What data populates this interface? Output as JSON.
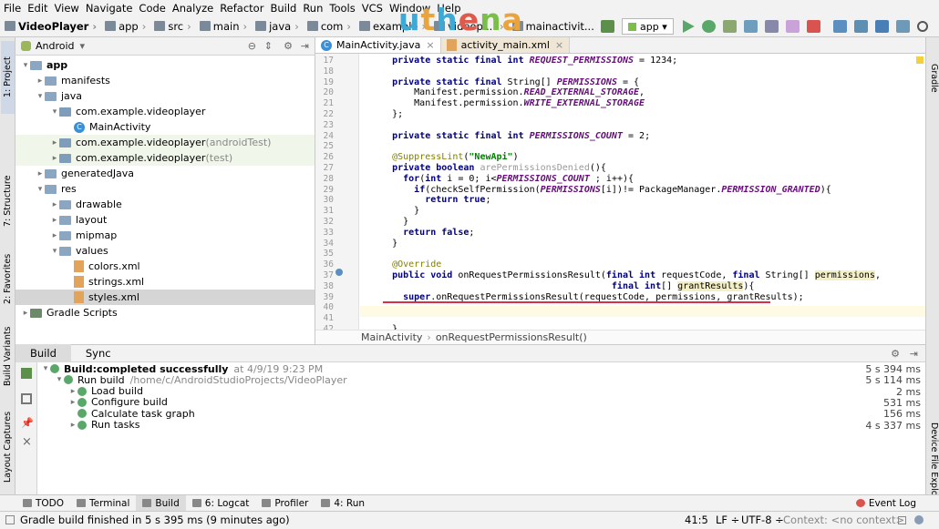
{
  "menu": [
    "File",
    "Edit",
    "View",
    "Navigate",
    "Code",
    "Analyze",
    "Refactor",
    "Build",
    "Run",
    "Tools",
    "VCS",
    "Window",
    "Help"
  ],
  "breadcrumb": [
    "VideoPlayer",
    "app",
    "src",
    "main",
    "java",
    "com",
    "example",
    "videopl...",
    "mainactivit..."
  ],
  "watermark": "uthena",
  "run_config": "app",
  "project_view": "Android",
  "tree": [
    {
      "label": "app",
      "depth": 0,
      "arrow": "▾",
      "icon": "folder"
    },
    {
      "label": "manifests",
      "depth": 1,
      "arrow": "▸",
      "icon": "folder"
    },
    {
      "label": "java",
      "depth": 1,
      "arrow": "▾",
      "icon": "folder"
    },
    {
      "label": "com.example.videoplayer",
      "depth": 2,
      "arrow": "▾",
      "icon": "package"
    },
    {
      "label": "MainActivity",
      "depth": 3,
      "arrow": "",
      "icon": "class"
    },
    {
      "label": "com.example.videoplayer",
      "suffix": " (androidTest)",
      "depth": 2,
      "arrow": "▸",
      "icon": "package"
    },
    {
      "label": "com.example.videoplayer",
      "suffix": " (test)",
      "depth": 2,
      "arrow": "▸",
      "icon": "package"
    },
    {
      "label": "generatedJava",
      "depth": 1,
      "arrow": "▸",
      "icon": "folder"
    },
    {
      "label": "res",
      "depth": 1,
      "arrow": "▾",
      "icon": "folder"
    },
    {
      "label": "drawable",
      "depth": 2,
      "arrow": "▸",
      "icon": "folder"
    },
    {
      "label": "layout",
      "depth": 2,
      "arrow": "▸",
      "icon": "folder"
    },
    {
      "label": "mipmap",
      "depth": 2,
      "arrow": "▸",
      "icon": "folder"
    },
    {
      "label": "values",
      "depth": 2,
      "arrow": "▾",
      "icon": "folder"
    },
    {
      "label": "colors.xml",
      "depth": 3,
      "arrow": "",
      "icon": "xml"
    },
    {
      "label": "strings.xml",
      "depth": 3,
      "arrow": "",
      "icon": "xml"
    },
    {
      "label": "styles.xml",
      "depth": 3,
      "arrow": "",
      "icon": "xml"
    },
    {
      "label": "Gradle Scripts",
      "depth": 0,
      "arrow": "▸",
      "icon": "gradle"
    }
  ],
  "left_tabs": [
    "1: Project",
    "7: Structure",
    "2: Favorites",
    "Build Variants",
    "Layout Captures"
  ],
  "right_tabs": [
    "Gradle",
    "Device File Explorer"
  ],
  "editor_tabs": [
    {
      "label": "MainActivity.java",
      "active": true
    },
    {
      "label": "activity_main.xml",
      "active": false
    }
  ],
  "code_lines": [
    {
      "n": "17",
      "html": "    <span class=\"kw\">private static final int</span> <span class=\"cn\">REQUEST_PERMISSIONS</span> = 1234;"
    },
    {
      "n": "18",
      "html": ""
    },
    {
      "n": "19",
      "html": "    <span class=\"kw\">private static final</span> String[] <span class=\"cn\">PERMISSIONS</span> = {"
    },
    {
      "n": "20",
      "html": "        Manifest.permission.<span class=\"cn\">READ_EXTERNAL_STORAGE</span>,"
    },
    {
      "n": "21",
      "html": "        Manifest.permission.<span class=\"cn\">WRITE_EXTERNAL_STORAGE</span>"
    },
    {
      "n": "22",
      "html": "    };"
    },
    {
      "n": "23",
      "html": ""
    },
    {
      "n": "24",
      "html": "    <span class=\"kw\">private static final int</span> <span class=\"cn\">PERMISSIONS_COUNT</span> = 2;"
    },
    {
      "n": "25",
      "html": ""
    },
    {
      "n": "26",
      "html": "    <span class=\"an\">@SuppressLint</span>(<span class=\"st\">\"NewApi\"</span>)"
    },
    {
      "n": "27",
      "html": "    <span class=\"kw\">private boolean</span> <span class=\"gr\">arePermissionsDenied</span>(){"
    },
    {
      "n": "28",
      "html": "      <span class=\"kw\">for</span>(<span class=\"kw\">int</span> i = 0; i&lt;<span class=\"cn\">PERMISSIONS_COUNT</span> ; i++){"
    },
    {
      "n": "29",
      "html": "        <span class=\"kw\">if</span>(checkSelfPermission(<span class=\"cn\">PERMISSIONS</span>[i])!= PackageManager.<span class=\"cn\">PERMISSION_GRANTED</span>){"
    },
    {
      "n": "30",
      "html": "          <span class=\"kw\">return true</span>;"
    },
    {
      "n": "31",
      "html": "        }"
    },
    {
      "n": "32",
      "html": "      }"
    },
    {
      "n": "33",
      "html": "      <span class=\"kw\">return false</span>;"
    },
    {
      "n": "34",
      "html": "    }"
    },
    {
      "n": "35",
      "html": ""
    },
    {
      "n": "36",
      "html": "    <span class=\"an\">@Override</span>"
    },
    {
      "n": "37",
      "html": "    <span class=\"kw\">public void</span> onRequestPermissionsResult(<span class=\"kw\">final int</span> requestCode, <span class=\"kw\">final</span> String[] <span style=\"background:#f5f0c4\">permissions</span>,"
    },
    {
      "n": "38",
      "html": "                                            <span class=\"kw\">final int</span>[] <span style=\"background:#f5f0c4\">grantResults</span>){"
    },
    {
      "n": "39",
      "html": "      <span class=\"kw\">super</span>.onRequestPermissionsResult(requestCode, permissions, grantResults);"
    },
    {
      "n": "40",
      "html": ""
    },
    {
      "n": "41",
      "html": ""
    },
    {
      "n": "42",
      "html": "    }"
    }
  ],
  "editor_breadcrumb": [
    "MainActivity",
    "onRequestPermissionsResult()"
  ],
  "build_tabs": [
    "Build",
    "Sync"
  ],
  "build_rows": [
    {
      "depth": 0,
      "arrow": "▾",
      "bold": "Build:",
      "text": " completed successfully",
      "extra": "at 4/9/19 9:23 PM",
      "time": "5 s 394 ms"
    },
    {
      "depth": 1,
      "arrow": "▾",
      "bold": "",
      "text": "Run build",
      "extra": "/home/c/AndroidStudioProjects/VideoPlayer",
      "time": "5 s 114 ms"
    },
    {
      "depth": 2,
      "arrow": "▸",
      "bold": "",
      "text": "Load build",
      "extra": "",
      "time": "2 ms"
    },
    {
      "depth": 2,
      "arrow": "▸",
      "bold": "",
      "text": "Configure build",
      "extra": "",
      "time": "531 ms"
    },
    {
      "depth": 2,
      "arrow": "",
      "bold": "",
      "text": "Calculate task graph",
      "extra": "",
      "time": "156 ms"
    },
    {
      "depth": 2,
      "arrow": "▸",
      "bold": "",
      "text": "Run tasks",
      "extra": "",
      "time": "4 s 337 ms"
    }
  ],
  "bottom_tabs": [
    {
      "label": "TODO",
      "active": false
    },
    {
      "label": "Terminal",
      "active": false
    },
    {
      "label": "Build",
      "active": true
    },
    {
      "label": "6: Logcat",
      "active": false
    },
    {
      "label": "Profiler",
      "active": false
    },
    {
      "label": "4: Run",
      "active": false
    }
  ],
  "event_log": "Event Log",
  "status": {
    "message": "Gradle build finished in 5 s 395 ms (9 minutes ago)",
    "position": "41:5",
    "line_sep": "LF ÷",
    "encoding": "UTF-8 ÷",
    "context": "Context: <no context>"
  }
}
